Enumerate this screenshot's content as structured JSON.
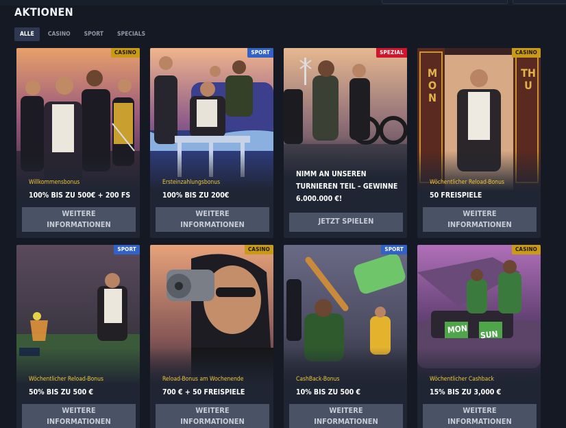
{
  "page": {
    "title": "AKTIONEN"
  },
  "tabs": [
    {
      "label": "ALLE",
      "active": true
    },
    {
      "label": "CASINO"
    },
    {
      "label": "SPORT"
    },
    {
      "label": "SPECIALS"
    }
  ],
  "promotions": [
    {
      "badge": "CASINO",
      "subtitle": "Willkommensbonus",
      "headline": "100% BIS ZU 500€ + 200 FS",
      "button_line1": "WEITERE",
      "button_line2": "INFORMATIONEN"
    },
    {
      "badge": "SPORT",
      "subtitle": "Ersteinzahlungsbonus",
      "headline": "100% BIS ZU 200€",
      "button_line1": "WEITERE",
      "button_line2": "INFORMATIONEN"
    },
    {
      "badge": "SPEZIAL",
      "headline_line1": "NIMM AN UNSEREN",
      "headline_line2": "TURNIEREN TEIL – GEWINNE",
      "headline_line3": "6.000.000 €!",
      "button_line1": "JETZT SPIELEN"
    },
    {
      "badge": "CASINO",
      "subtitle": "Wöchentlicher Reload-Bonus",
      "headline": "50 FREISPIELE",
      "button_line1": "WEITERE",
      "button_line2": "INFORMATIONEN",
      "door_left": "MON",
      "door_right": "THU"
    },
    {
      "badge": "SPORT",
      "subtitle": "Wöchentlicher Reload-Bonus",
      "headline": "50% BIS ZU 500 €",
      "button_line1": "WEITERE",
      "button_line2": "INFORMATIONEN"
    },
    {
      "badge": "CASINO",
      "subtitle": "Reload-Bonus am Wochenende",
      "headline": "700 € + 50 FREISPIELE",
      "button_line1": "WEITERE",
      "button_line2": "INFORMATIONEN"
    },
    {
      "badge": "SPORT",
      "subtitle": "CashBack-Bonus",
      "headline": "10% BIS ZU 500 €",
      "button_line1": "WEITERE",
      "button_line2": "INFORMATIONEN"
    },
    {
      "badge": "CASINO",
      "subtitle": "Wöchentlicher Cashback",
      "headline": "15% BIS ZU 3,000 €",
      "button_line1": "WEITERE",
      "button_line2": "INFORMATIONEN",
      "bag_left": "MON",
      "bag_right": "SUN"
    }
  ]
}
